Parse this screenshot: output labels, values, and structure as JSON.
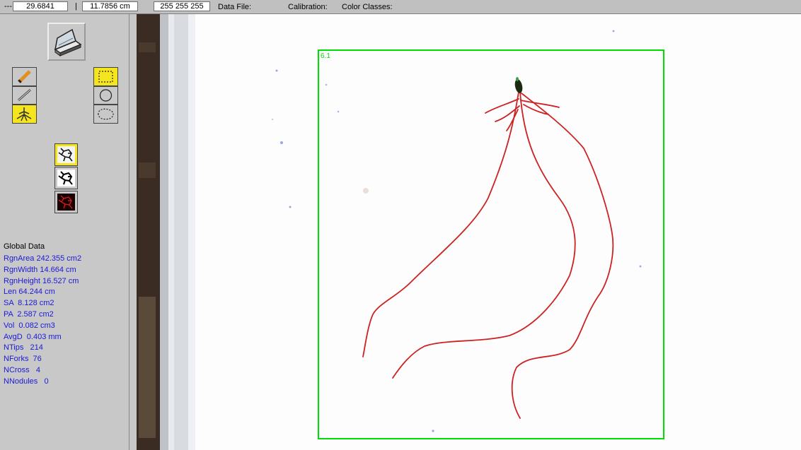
{
  "status_bar": {
    "prefix": "---",
    "field_1": "29.6841",
    "separator": "|",
    "field_2": "11.7856 cm",
    "field_3": "255 255 255",
    "data_file_label": "Data File:",
    "calibration_label": "Calibration:",
    "color_classes_label": "Color Classes:"
  },
  "toolbar": {
    "scanner": "scanner-icon",
    "draw_tools": [
      "pencil-icon",
      "line-icon",
      "root-icon"
    ],
    "select_tools": [
      "rect-select-icon",
      "circle-select-icon",
      "lasso-select-icon"
    ],
    "view_modes": [
      "original-image-icon",
      "binary-image-icon",
      "skeleton-image-icon"
    ],
    "active": [
      "root-icon",
      "rect-select-icon",
      "original-image-icon"
    ],
    "accent_color": "#f5e51e"
  },
  "global_data": {
    "title": "Global Data",
    "items": [
      "RgnArea 242.355 cm2",
      "RgnWidth 14.664 cm",
      "RgnHeight 16.527 cm",
      "Len 64.244 cm",
      "SA  8.128 cm2",
      "PA  2.587 cm2",
      "Vol  0.082 cm3",
      "AvgD  0.403 mm",
      "NTips   214",
      "NForks  76",
      "NCross   4",
      "NNodules   0"
    ],
    "text_color": "#1a1ad8"
  },
  "image": {
    "roi_label": "6.1",
    "roi_color": "#00dd00",
    "root_color": "#cc2222"
  }
}
